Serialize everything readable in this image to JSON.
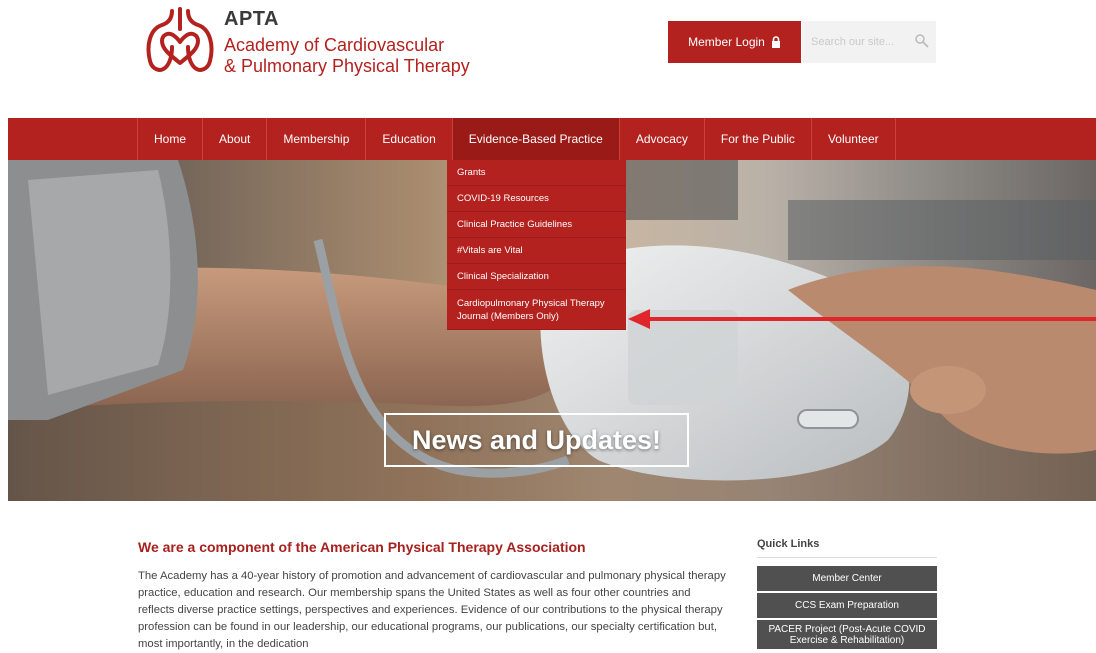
{
  "header": {
    "logo_title": "APTA",
    "logo_line1": "Academy of Cardiovascular",
    "logo_line2": "& Pulmonary Physical Therapy",
    "login_label": "Member Login",
    "search_placeholder": "Search our site..."
  },
  "nav": {
    "items": [
      "Home",
      "About",
      "Membership",
      "Education",
      "Evidence-Based Practice",
      "Advocacy",
      "For the Public",
      "Volunteer"
    ],
    "active": "Evidence-Based Practice"
  },
  "dropdown": {
    "items": [
      "Grants",
      "COVID-19 Resources",
      "Clinical Practice Guidelines",
      "#Vitals are Vital",
      "Clinical Specialization",
      "Cardiopulmonary Physical Therapy Journal (Members Only)"
    ]
  },
  "hero": {
    "title": "News and Updates!"
  },
  "content": {
    "heading": "We are a component of the American Physical Therapy Association",
    "body": "The Academy has a 40-year history of promotion and advancement of cardiovascular and pulmonary physical therapy practice, education and research. Our membership spans the United States as well as four other countries and reflects diverse practice settings, perspectives and experiences. Evidence of our contributions to the physical therapy profession can be found in our leadership, our educational programs, our publications, our specialty certification but, most importantly, in the dedication"
  },
  "quick_links": {
    "title": "Quick Links",
    "items": [
      "Member Center",
      "CCS Exam Preparation",
      "PACER Project (Post-Acute COVID Exercise & Rehabilitation)"
    ]
  },
  "colors": {
    "brand": "#b3221f",
    "active_nav": "#9a1a17",
    "quick_link_bg": "#505050",
    "arrow": "#e0262b"
  }
}
